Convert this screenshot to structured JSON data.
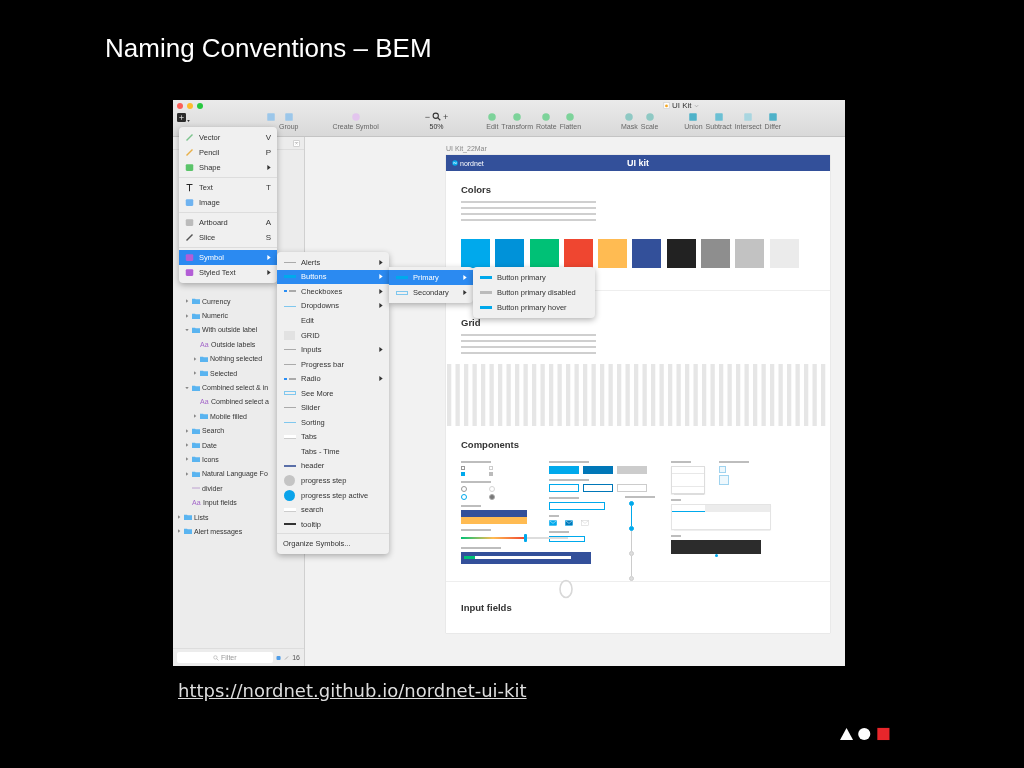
{
  "slide": {
    "title": "Naming Conventions – BEM",
    "url": "https://nordnet.github.io/nordnet-ui-kit"
  },
  "window": {
    "title": "UI Kit"
  },
  "toolbar": {
    "groups": [
      [
        {
          "kind": "insert"
        }
      ],
      [
        {
          "kind": "frame"
        },
        {
          "kind": "group",
          "label": "Group"
        }
      ],
      [
        {
          "kind": "symbol",
          "label": "Create Symbol"
        }
      ],
      [
        {
          "kind": "zoom",
          "minus": "−",
          "plus": "+",
          "label": "50%"
        }
      ],
      [
        {
          "kind": "edit",
          "label": "Edit"
        },
        {
          "kind": "transform",
          "label": "Transform"
        },
        {
          "kind": "rotate",
          "label": "Rotate"
        },
        {
          "kind": "flatten",
          "label": "Flatten"
        }
      ],
      [
        {
          "kind": "mask",
          "label": "Mask"
        },
        {
          "kind": "scale",
          "label": "Scale"
        }
      ],
      [
        {
          "kind": "union",
          "label": "Union"
        },
        {
          "kind": "subtract",
          "label": "Subtract"
        },
        {
          "kind": "intersect",
          "label": "Intersect"
        },
        {
          "kind": "difference",
          "label": "Differ"
        }
      ]
    ]
  },
  "layers": [
    {
      "kind": "covered",
      "children": [
        {
          "kind": "folder",
          "name": "Currency",
          "expanded": false
        },
        {
          "kind": "folder",
          "name": "Numeric",
          "expanded": false
        },
        {
          "kind": "folder",
          "name": "With outside label",
          "expanded": true,
          "children": [
            {
              "kind": "text",
              "glyph": "Aa",
              "name": "Outside labels"
            },
            {
              "kind": "folder",
              "name": "Nothing selected",
              "expanded": false
            },
            {
              "kind": "folder",
              "name": "Selected",
              "expanded": false
            }
          ]
        },
        {
          "kind": "folder",
          "name": "Combined select & in",
          "expanded": true,
          "children": [
            {
              "kind": "text",
              "glyph": "Aa",
              "name": "Combined select a"
            },
            {
              "kind": "folder",
              "name": "Mobile filled",
              "expanded": false
            }
          ]
        },
        {
          "kind": "folder",
          "name": "Search",
          "expanded": false
        },
        {
          "kind": "folder",
          "name": "Date",
          "expanded": false
        },
        {
          "kind": "folder",
          "name": "Icons",
          "expanded": false
        },
        {
          "kind": "folder",
          "name": "Natural Language Fo",
          "expanded": false
        },
        {
          "kind": "line",
          "name": "divider"
        },
        {
          "kind": "text",
          "glyph": "Aa",
          "name": "Input fields"
        }
      ]
    },
    {
      "kind": "folder",
      "name": "Lists",
      "expanded": false
    },
    {
      "kind": "folder",
      "name": "Alert messages",
      "expanded": false
    }
  ],
  "filter": {
    "placeholder": "Filter",
    "count": "16"
  },
  "insert_menu": [
    {
      "kind": "vector",
      "label": "Vector",
      "shortcut": "V",
      "submenu": false,
      "selected": false
    },
    {
      "kind": "pencil",
      "label": "Pencil",
      "shortcut": "P",
      "submenu": false,
      "selected": false
    },
    {
      "kind": "shape",
      "label": "Shape",
      "submenu": true,
      "selected": false
    },
    {
      "kind": "separator"
    },
    {
      "kind": "text",
      "label": "Text",
      "shortcut": "T",
      "submenu": false,
      "selected": false
    },
    {
      "kind": "image",
      "label": "Image",
      "submenu": false,
      "selected": false
    },
    {
      "kind": "separator"
    },
    {
      "kind": "artboard",
      "label": "Artboard",
      "shortcut": "A",
      "submenu": false,
      "selected": false
    },
    {
      "kind": "slice",
      "label": "Slice",
      "shortcut": "S",
      "submenu": false,
      "selected": false
    },
    {
      "kind": "separator"
    },
    {
      "kind": "symbol",
      "label": "Symbol",
      "submenu": true,
      "selected": true
    },
    {
      "kind": "styled-text",
      "label": "Styled Text",
      "submenu": true,
      "selected": false
    }
  ],
  "symbol_menu": [
    {
      "kind": "thin",
      "label": "Alerts",
      "submenu": true,
      "selected": false
    },
    {
      "kind": "bar",
      "label": "Buttons",
      "submenu": true,
      "selected": true
    },
    {
      "kind": "check",
      "label": "Checkboxes",
      "submenu": true,
      "selected": false
    },
    {
      "kind": "dash",
      "label": "Dropdowns",
      "submenu": true,
      "selected": false
    },
    {
      "kind": "none",
      "label": "Edit",
      "submenu": false,
      "selected": false
    },
    {
      "kind": "grid",
      "label": "GRID",
      "submenu": false,
      "selected": false
    },
    {
      "kind": "thin",
      "label": "Inputs",
      "submenu": true,
      "selected": false
    },
    {
      "kind": "thin",
      "label": "Progress bar",
      "submenu": false,
      "selected": false
    },
    {
      "kind": "check",
      "label": "Radio",
      "submenu": true,
      "selected": false
    },
    {
      "kind": "outline",
      "label": "See More",
      "submenu": false,
      "selected": false
    },
    {
      "kind": "thin",
      "label": "Slider",
      "submenu": false,
      "selected": false
    },
    {
      "kind": "dash",
      "label": "Sorting",
      "submenu": false,
      "selected": false
    },
    {
      "kind": "tab",
      "label": "Tabs",
      "submenu": false,
      "selected": false
    },
    {
      "kind": "none",
      "label": "Tabs - Time",
      "submenu": false,
      "selected": false
    },
    {
      "kind": "header",
      "label": "header",
      "submenu": false,
      "selected": false
    },
    {
      "kind": "grey-circle",
      "label": "progress step",
      "submenu": false,
      "selected": false
    },
    {
      "kind": "blue-circle",
      "label": "progress step active",
      "submenu": false,
      "selected": false
    },
    {
      "kind": "tab",
      "label": "search",
      "submenu": false,
      "selected": false
    },
    {
      "kind": "dark",
      "label": "tooltip",
      "submenu": false,
      "selected": false
    },
    {
      "kind": "separator"
    },
    {
      "kind": "plain",
      "label": "Organize Symbols...",
      "submenu": false,
      "selected": false
    }
  ],
  "buttons_menu": [
    {
      "kind": "bar",
      "label": "Primary",
      "submenu": true,
      "selected": true
    },
    {
      "kind": "outline",
      "label": "Secondary",
      "submenu": true,
      "selected": false
    }
  ],
  "primary_menu": [
    {
      "kind": "bar",
      "label": "Button primary",
      "submenu": false,
      "selected": false
    },
    {
      "kind": "greybar",
      "label": "Button primary disabled",
      "submenu": false,
      "selected": false
    },
    {
      "kind": "bar",
      "label": "Button primary hover",
      "submenu": false,
      "selected": false
    }
  ],
  "artboard": {
    "label": "UI Kit_22Mar",
    "brand": "nordnet",
    "title": "UI kit",
    "colors": {
      "heading": "Colors",
      "swatches": [
        {
          "color": "#00a9ec"
        },
        {
          "color": "#0092d9"
        },
        {
          "color": "#00c176"
        },
        {
          "color": "#ef4630"
        },
        {
          "color": "#ffbb52"
        },
        {
          "color": "#33509a"
        },
        {
          "color": "#222222"
        },
        {
          "color": "#8e8e8e"
        },
        {
          "color": "#c2c2c2"
        },
        {
          "color": "#ebebeb"
        }
      ]
    },
    "grid": {
      "heading": "Grid"
    },
    "components": {
      "heading": "Components",
      "checkboxes": [
        {
          "checked": false,
          "disabled": false
        },
        {
          "checked": false,
          "disabled": true
        },
        {
          "checked": true,
          "disabled": false
        },
        {
          "checked": true,
          "disabled": true
        }
      ],
      "radios": [
        {
          "selected": false,
          "disabled": false
        },
        {
          "selected": false,
          "disabled": true
        },
        {
          "selected": true,
          "disabled": false
        },
        {
          "selected": true,
          "disabled": true
        }
      ],
      "link_blocks": [
        {
          "color": "#33509a"
        },
        {
          "color": "#ffbb52"
        }
      ],
      "slider": {
        "level": 0.6
      },
      "progress": {
        "level": 0.1
      },
      "primary_buttons": [
        {
          "hover": false,
          "disabled": false
        },
        {
          "hover": true,
          "disabled": false
        },
        {
          "hover": false,
          "disabled": true
        }
      ],
      "secondary_buttons": [
        {
          "hover": false,
          "disabled": false
        },
        {
          "hover": true,
          "disabled": false
        },
        {
          "hover": false,
          "disabled": true
        }
      ],
      "icons": [
        {
          "hover": false,
          "disabled": false
        },
        {
          "hover": true,
          "disabled": false
        },
        {
          "hover": false,
          "disabled": true
        }
      ],
      "steps": [
        {
          "active": true
        },
        {
          "active": true
        },
        {
          "active": false
        },
        {
          "active": false
        }
      ],
      "tabs": [
        {
          "selected": true
        },
        {
          "selected": false
        },
        {
          "selected": false
        }
      ]
    },
    "inputs": {
      "heading": "Input fields"
    }
  }
}
